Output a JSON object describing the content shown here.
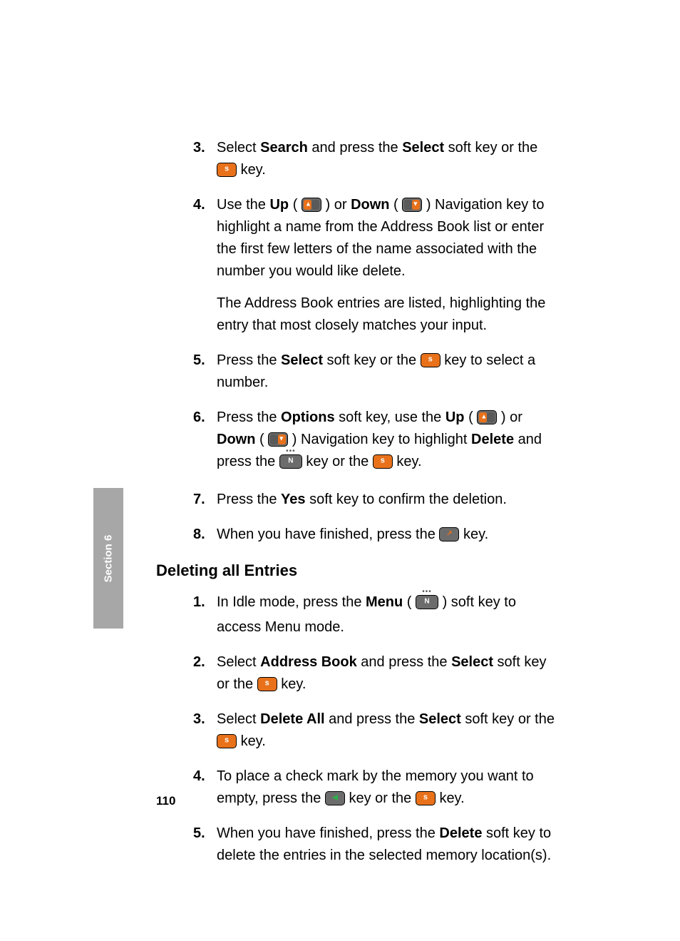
{
  "sideTab": "Section 6",
  "pageNumber": "110",
  "listA": {
    "s3": {
      "num": "3.",
      "t1": "Select ",
      "b1": "Search",
      "t2": " and press the ",
      "b2": "Select",
      "t3": " soft key or the ",
      "t4": " key."
    },
    "s4": {
      "num": "4.",
      "t1": "Use the ",
      "b1": "Up",
      "t2": " (",
      "t3": ") or ",
      "b2": "Down",
      "t4": " (",
      "t5": ") Navigation key to highlight a name from the Address Book list or enter the first few letters of the name associated with the number you would like delete.",
      "extra": "The Address Book entries are listed, highlighting the entry that most closely matches your input."
    },
    "s5": {
      "num": "5.",
      "t1": "Press the ",
      "b1": "Select",
      "t2": " soft key or the ",
      "t3": " key to select a number."
    },
    "s6": {
      "num": "6.",
      "t1": "Press the ",
      "b1": "Options",
      "t2": " soft key, use the ",
      "b2": "Up",
      "t3": " (",
      "t4": ") or ",
      "b3": "Down",
      "t5": " (",
      "t6": ") Navigation key to highlight ",
      "b4": "Delete",
      "t7": " and press the ",
      "t8": " key or the ",
      "t9": " key."
    },
    "s7": {
      "num": "7.",
      "t1": "Press the ",
      "b1": "Yes",
      "t2": " soft key to confirm the deletion."
    },
    "s8": {
      "num": "8.",
      "t1": "When you have finished, press the ",
      "t2": " key."
    }
  },
  "subhead": "Deleting all Entries",
  "listB": {
    "s1": {
      "num": "1.",
      "t1": "In Idle mode, press the ",
      "b1": "Menu",
      "t2": " (",
      "t3": ") soft key to access Menu mode."
    },
    "s2": {
      "num": "2.",
      "t1": "Select ",
      "b1": "Address Book",
      "t2": " and press the ",
      "b2": "Select",
      "t3": " soft key or the ",
      "t4": " key."
    },
    "s3": {
      "num": "3.",
      "t1": "Select ",
      "b1": "Delete All",
      "t2": " and press the ",
      "b2": "Select",
      "t3": " soft key or the ",
      "t4": " key."
    },
    "s4": {
      "num": "4.",
      "t1": "To place a check mark by the memory you want to empty, press the ",
      "t2": " key or the ",
      "t3": " key."
    },
    "s5": {
      "num": "5.",
      "t1": "When you have finished, press the ",
      "b1": "Delete",
      "t2": " soft key to delete the entries in the selected memory location(s)."
    }
  }
}
